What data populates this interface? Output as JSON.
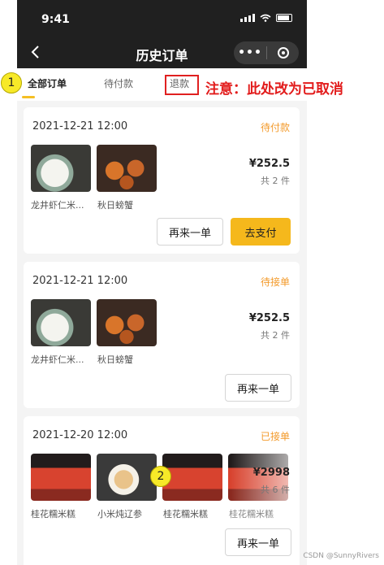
{
  "status_bar": {
    "time": "9:41"
  },
  "nav": {
    "title": "历史订单",
    "more": "•••"
  },
  "tabs": [
    {
      "label": "全部订单"
    },
    {
      "label": "待付款"
    },
    {
      "label": "退款"
    }
  ],
  "annotation": {
    "marker_1": "1",
    "marker_2": "2",
    "note": "注意：此处改为已取消"
  },
  "orders": [
    {
      "date": "2021-12-21 12:00",
      "status": "待付款",
      "price": "¥252.5",
      "count": "共 2 件",
      "items": [
        "龙井虾仁米...",
        "秋日螃蟹"
      ],
      "buttons": [
        "再来一单",
        "去支付"
      ]
    },
    {
      "date": "2021-12-21 12:00",
      "status": "待接单",
      "price": "¥252.5",
      "count": "共 2 件",
      "items": [
        "龙井虾仁米...",
        "秋日螃蟹"
      ],
      "buttons": [
        "再来一单"
      ]
    },
    {
      "date": "2021-12-20 12:00",
      "status": "已接单",
      "price": "¥2998",
      "count": "共 6 件",
      "items": [
        "桂花糯米糕",
        "小米炖辽参",
        "桂花糯米糕",
        "桂花糯米糕"
      ],
      "buttons": [
        "再来一单"
      ]
    }
  ],
  "watermark": "CSDN @SunnyRivers",
  "colors": {
    "accent": "#f5b81c",
    "status": "#f39a2b",
    "annotation": "#e21b1b"
  }
}
